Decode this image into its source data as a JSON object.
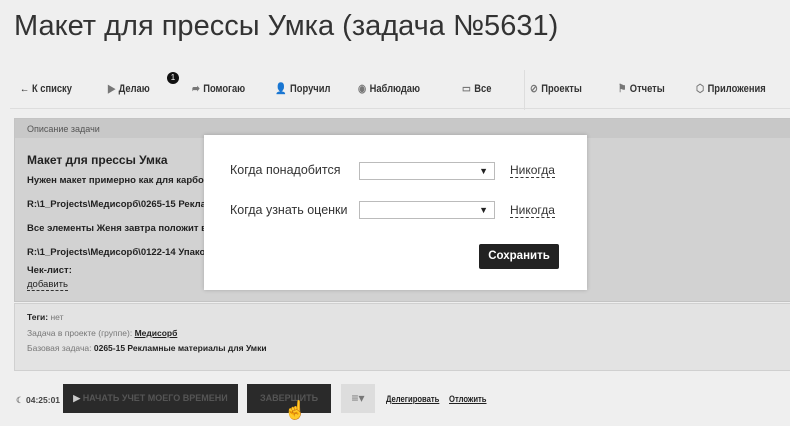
{
  "page_title": "Макет для прессы Умка (задача №5631)",
  "nav": {
    "back": "← К списку",
    "doing": "Делаю",
    "doing_badge": "1",
    "helping": "Помогаю",
    "assigned": "Поручил",
    "watching": "Наблюдаю",
    "all": "Все",
    "projects": "Проекты",
    "reports": "Отчеты",
    "apps": "Приложения"
  },
  "description": {
    "header": "Описание задачи",
    "title": "Макет для прессы Умка",
    "line1": "Нужен макет примерно как для карбопекта",
    "line2": "R:\\1_Projects\\Медисорб\\0265-15 Рекламные",
    "line3": "Все элементы Женя завтра положит в мате",
    "line4": "R:\\1_Projects\\Медисорб\\0122-14 Упаковка У",
    "checklist": "Чек-лист:",
    "add": "добавить"
  },
  "meta": {
    "tags_label": "Теги:",
    "tags_value": "нет",
    "project_label": "Задача в проекте (группе):",
    "project_value": "Медисорб",
    "base_label": "Базовая задача:",
    "base_value": "0265-15 Рекламные материалы для Умки"
  },
  "modal": {
    "when_needed": "Когда понадобится",
    "when_estimate": "Когда узнать оценки",
    "select_value": "",
    "never1": "Никогда",
    "never2": "Никогда",
    "save": "Сохранить"
  },
  "footer": {
    "timer": "04:25:01",
    "start": "НАЧАТЬ УЧЕТ МОЕГО ВРЕМЕНИ",
    "finish": "ЗАВЕРШИТЬ",
    "delegate": "Делегировать",
    "postpone": "Отложить"
  }
}
